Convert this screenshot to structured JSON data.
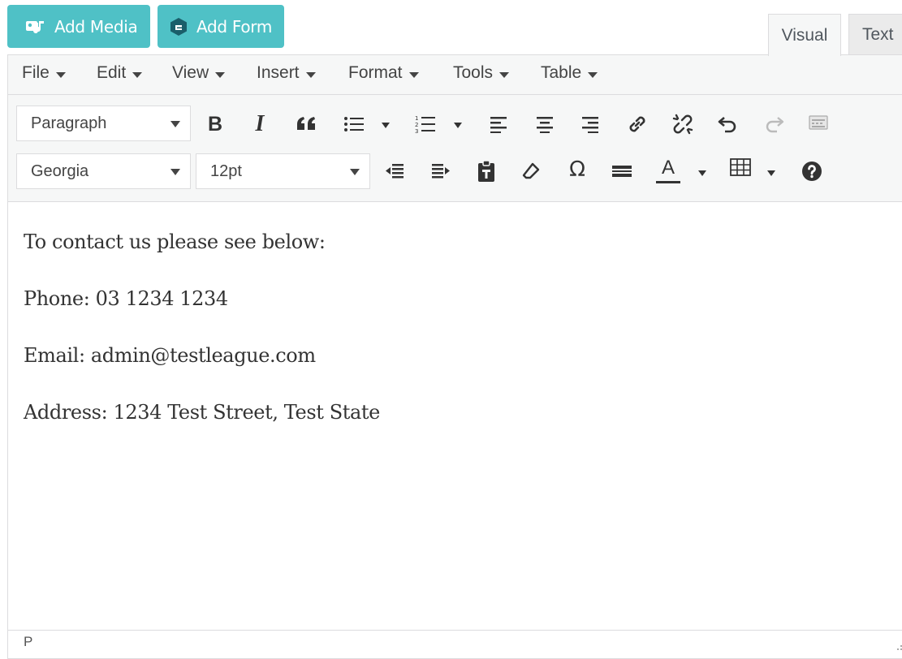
{
  "media_buttons": {
    "add_media": "Add Media",
    "add_form": "Add Form"
  },
  "tabs": {
    "visual": "Visual",
    "text": "Text"
  },
  "menubar": {
    "items": [
      "File",
      "Edit",
      "View",
      "Insert",
      "Format",
      "Tools",
      "Table"
    ]
  },
  "toolbar": {
    "block_format": "Paragraph",
    "font_family": "Georgia",
    "font_size": "12pt",
    "bold_glyph": "B",
    "italic_glyph": "I",
    "omega_glyph": "Ω",
    "text_color_glyph": "A"
  },
  "content": {
    "paragraphs": [
      "To contact us please see below:",
      "Phone: 03 1234 1234",
      "Email: admin@testleague.com",
      "Address: 1234 Test Street, Test State"
    ]
  },
  "statusbar": {
    "path": "P"
  },
  "colors": {
    "button_teal": "#4fc1c6",
    "toolbar_bg": "#f6f7f7",
    "border": "#dcdcde",
    "text": "#333333"
  },
  "icons": [
    "add-media-icon",
    "add-form-icon",
    "bold-icon",
    "italic-icon",
    "blockquote-icon",
    "bullet-list-icon",
    "numbered-list-icon",
    "align-left-icon",
    "align-center-icon",
    "align-right-icon",
    "link-icon",
    "unlink-icon",
    "undo-icon",
    "redo-icon",
    "toolbar-toggle-icon",
    "outdent-icon",
    "indent-icon",
    "paste-text-icon",
    "clear-formatting-icon",
    "special-character-icon",
    "horizontal-line-icon",
    "text-color-icon",
    "table-icon",
    "help-icon",
    "resize-handle-icon"
  ]
}
